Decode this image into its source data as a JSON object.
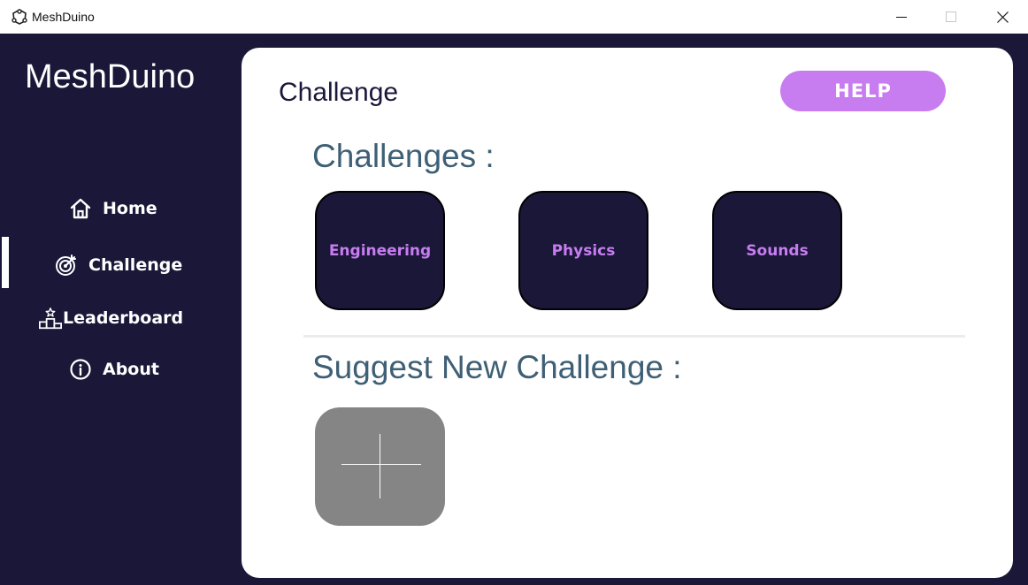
{
  "window": {
    "title": "MeshDuino"
  },
  "sidebar": {
    "brand": "MeshDuino",
    "items": [
      {
        "label": "Home",
        "icon": "home-icon"
      },
      {
        "label": "Challenge",
        "icon": "target-icon",
        "active": true
      },
      {
        "label": "Leaderboard",
        "icon": "podium-icon"
      },
      {
        "label": "About",
        "icon": "info-icon"
      }
    ]
  },
  "main": {
    "page_title": "Challenge",
    "help_label": "HELP",
    "challenges_heading": "Challenges :",
    "challenges": [
      {
        "label": "Engineering"
      },
      {
        "label": "Physics"
      },
      {
        "label": "Sounds"
      }
    ],
    "suggest_heading": "Suggest New Challenge :",
    "add_icon": "plus-icon"
  },
  "colors": {
    "sidebar_bg": "#1a1738",
    "accent": "#c77df0",
    "heading": "#3e5f75",
    "add_button": "#858585"
  }
}
